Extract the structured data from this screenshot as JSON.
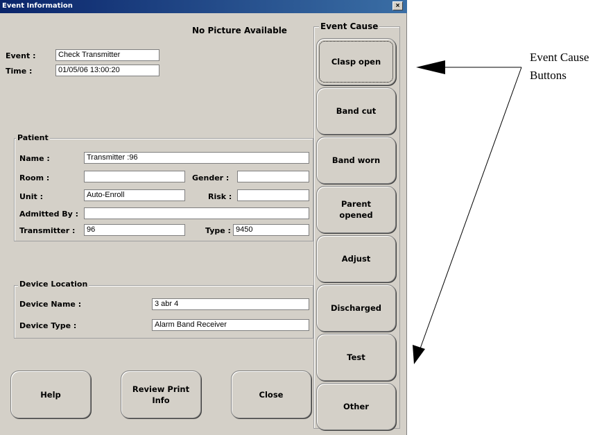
{
  "window": {
    "title": "Event Information",
    "close_glyph": "×",
    "close_icon": "close-icon"
  },
  "picture": {
    "text": "No Picture Available"
  },
  "event": {
    "event_label": "Event :",
    "event_value": "Check Transmitter",
    "time_label": "Time :",
    "time_value": "01/05/06 13:00:20"
  },
  "patient": {
    "title": "Patient",
    "name_label": "Name :",
    "name_value": "Transmitter :96",
    "room_label": "Room :",
    "room_value": "",
    "gender_label": "Gender :",
    "gender_value": "",
    "unit_label": "Unit :",
    "unit_value": "Auto-Enroll",
    "risk_label": "Risk :",
    "risk_value": "",
    "admitted_label": "Admitted By :",
    "admitted_value": "",
    "transmitter_label": "Transmitter :",
    "transmitter_value": "96",
    "type_label": "Type :",
    "type_value": "9450"
  },
  "device": {
    "title": "Device Location",
    "name_label": "Device Name :",
    "name_value": "3 abr 4",
    "type_label": "Device Type :",
    "type_value": "Alarm Band Receiver"
  },
  "bottom_buttons": {
    "help": "Help",
    "review": "Review Print\nInfo",
    "close": "Close"
  },
  "event_cause": {
    "title": "Event Cause",
    "buttons": [
      "Clasp open",
      "Band cut",
      "Band worn",
      "Parent\nopened",
      "Adjust",
      "Discharged",
      "Test",
      "Other"
    ]
  },
  "annotation": {
    "line1": "Event Cause",
    "line2": "Buttons"
  }
}
